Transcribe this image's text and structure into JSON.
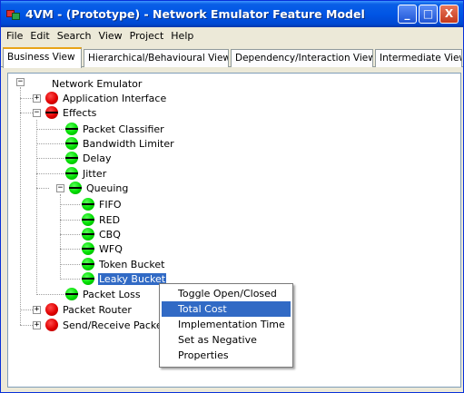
{
  "window": {
    "title": "4VM - (Prototype) - Network Emulator Feature Model",
    "controls": {
      "minimize": "_",
      "maximize": "□",
      "close": "X"
    }
  },
  "menu": [
    "File",
    "Edit",
    "Search",
    "View",
    "Project",
    "Help"
  ],
  "tabs": [
    {
      "label": "Business View",
      "active": true
    },
    {
      "label": "Hierarchical/Behavioural View",
      "active": false
    },
    {
      "label": "Dependency/Interaction View",
      "active": false
    },
    {
      "label": "Intermediate View",
      "active": false
    }
  ],
  "tree": {
    "root": {
      "label": "Network Emulator",
      "expander": "−"
    },
    "nodes": [
      {
        "label": "Application Interface",
        "status": "red",
        "negated": false,
        "expander": "+"
      },
      {
        "label": "Effects",
        "status": "red",
        "negated": true,
        "expander": "−"
      },
      {
        "label": "Packet Classifier",
        "status": "green",
        "negated": true
      },
      {
        "label": "Bandwidth Limiter",
        "status": "green",
        "negated": true
      },
      {
        "label": "Delay",
        "status": "green",
        "negated": true
      },
      {
        "label": "Jitter",
        "status": "green",
        "negated": true
      },
      {
        "label": "Queuing",
        "status": "green",
        "negated": true,
        "expander": "−"
      },
      {
        "label": "FIFO",
        "status": "green",
        "negated": true
      },
      {
        "label": "RED",
        "status": "green",
        "negated": true
      },
      {
        "label": "CBQ",
        "status": "green",
        "negated": true
      },
      {
        "label": "WFQ",
        "status": "green",
        "negated": true
      },
      {
        "label": "Token Bucket",
        "status": "green",
        "negated": true
      },
      {
        "label": "Leaky Bucket",
        "status": "green",
        "negated": true,
        "selected": true
      },
      {
        "label": "Packet Loss",
        "status": "green",
        "negated": true
      },
      {
        "label": "Packet Router",
        "status": "red",
        "negated": false,
        "expander": "+"
      },
      {
        "label": "Send/Receive Packets",
        "status": "red",
        "negated": false,
        "expander": "+"
      }
    ]
  },
  "context_menu": {
    "items": [
      {
        "label": "Toggle Open/Closed",
        "highlighted": false
      },
      {
        "label": "Total Cost",
        "highlighted": true
      },
      {
        "label": "Implementation Time",
        "highlighted": false
      },
      {
        "label": "Set as Negative",
        "highlighted": false
      },
      {
        "label": "Properties",
        "highlighted": false
      }
    ]
  },
  "colors": {
    "titlebar": "#0055e5",
    "selection": "#316ac5",
    "status_red": "#e00000",
    "status_green": "#00dd00",
    "active_tab_accent": "#e8a317"
  }
}
